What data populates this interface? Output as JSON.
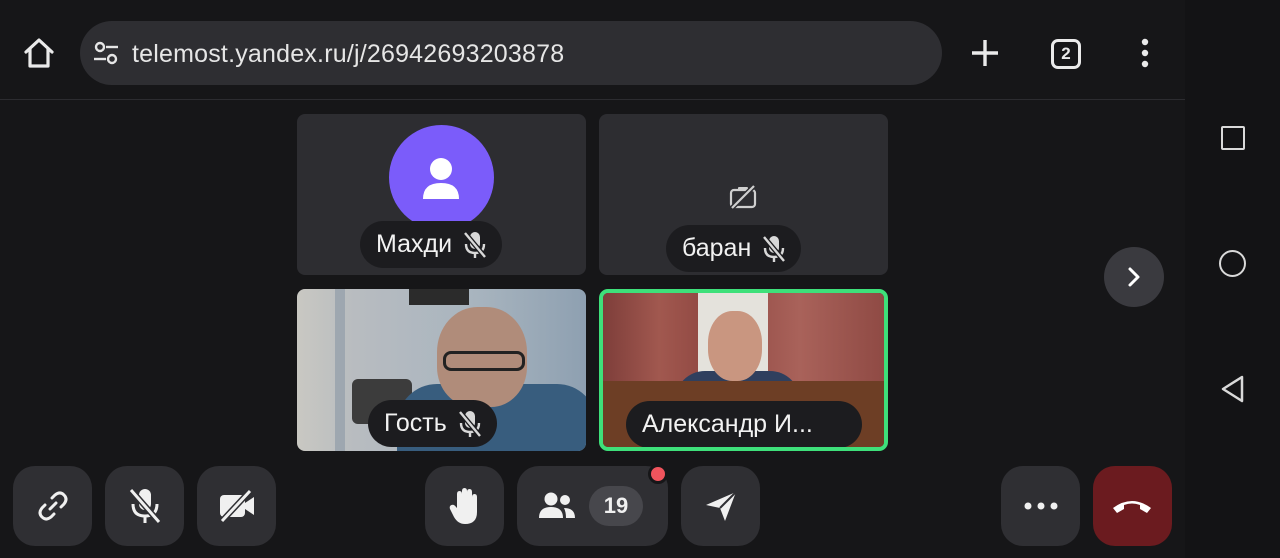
{
  "browser": {
    "url": "telemost.yandex.ru/j/26942693203878",
    "tab_count": "2",
    "icons": [
      "home-icon",
      "site-settings-icon",
      "new-tab-plus-icon",
      "tab-switcher-icon",
      "browser-menu-icon"
    ]
  },
  "participants": [
    {
      "name": "Махди",
      "muted": true,
      "video": "avatar",
      "speaking": false
    },
    {
      "name": "баран",
      "muted": true,
      "video": "camera-off",
      "speaking": false
    },
    {
      "name": "Гость",
      "muted": true,
      "video": "camera",
      "speaking": false
    },
    {
      "name": "Александр И...",
      "muted": false,
      "video": "camera",
      "speaking": true
    }
  ],
  "toolbar": {
    "participants_count": "19",
    "buttons": [
      "copy-link",
      "microphone-off",
      "camera-off",
      "raise-hand",
      "participants",
      "share",
      "more",
      "leave-call"
    ]
  },
  "colors": {
    "speaking_border": "#3ee07a",
    "avatar_bg": "#7b5cfa",
    "leave_button": "#6b1b1f",
    "notification_dot": "#f0545d"
  }
}
